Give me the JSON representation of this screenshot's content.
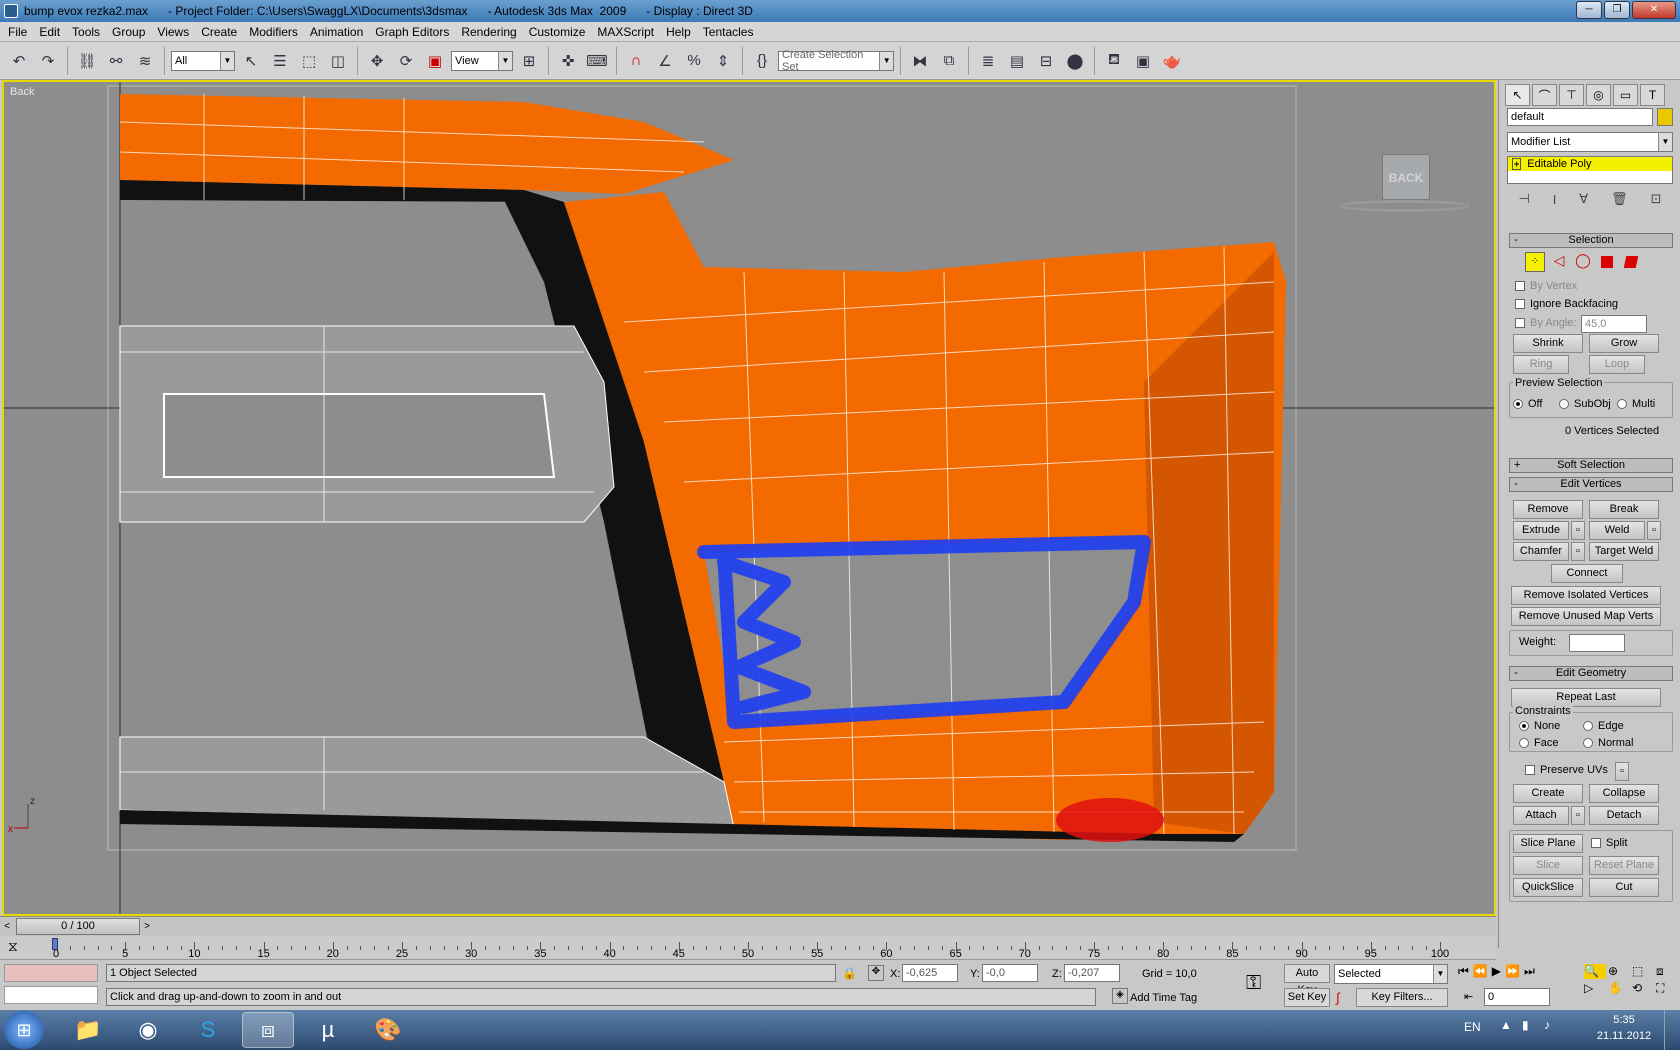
{
  "window": {
    "title": "bump evox rezka2.max      - Project Folder: C:\\Users\\SwaggLX\\Documents\\3dsmax      - Autodesk 3ds Max  2009      - Display : Direct 3D"
  },
  "menu": [
    "File",
    "Edit",
    "Tools",
    "Group",
    "Views",
    "Create",
    "Modifiers",
    "Animation",
    "Graph Editors",
    "Rendering",
    "Customize",
    "MAXScript",
    "Help",
    "Tentacles"
  ],
  "toolbar": {
    "filter_value": "All",
    "ref_coord_value": "View",
    "selection_set_placeholder": "Create Selection Set"
  },
  "viewport": {
    "label": "Back",
    "viewcube_label": "BACK"
  },
  "command_panel": {
    "object_name": "default",
    "modifier_list": "Modifier List",
    "stack_item": "Editable Poly",
    "object_color": "#e8c800",
    "selection": {
      "header": "Selection",
      "by_vertex": "By Vertex",
      "ignore_backfacing": "Ignore Backfacing",
      "by_angle": "By Angle:",
      "angle_value": "45,0",
      "shrink": "Shrink",
      "grow": "Grow",
      "ring": "Ring",
      "loop": "Loop",
      "preview_title": "Preview Selection",
      "preview_off": "Off",
      "preview_subobj": "SubObj",
      "preview_multi": "Multi",
      "status": "0 Vertices Selected"
    },
    "soft_selection": "Soft Selection",
    "edit_vertices": {
      "header": "Edit Vertices",
      "remove": "Remove",
      "break": "Break",
      "extrude": "Extrude",
      "weld": "Weld",
      "chamfer": "Chamfer",
      "target_weld": "Target Weld",
      "connect": "Connect",
      "remove_isolated": "Remove Isolated Vertices",
      "remove_unused": "Remove Unused Map Verts",
      "weight": "Weight:"
    },
    "edit_geometry": {
      "header": "Edit Geometry",
      "repeat_last": "Repeat Last",
      "constraints": "Constraints",
      "none": "None",
      "edge": "Edge",
      "face": "Face",
      "normal": "Normal",
      "preserve_uvs": "Preserve UVs",
      "create": "Create",
      "collapse": "Collapse",
      "attach": "Attach",
      "detach": "Detach",
      "slice_plane": "Slice Plane",
      "split": "Split",
      "slice": "Slice",
      "reset_plane": "Reset Plane",
      "quickslice": "QuickSlice",
      "cut": "Cut"
    }
  },
  "timeline": {
    "frame_display": "0 / 100",
    "ticks": [
      "0",
      "5",
      "10",
      "15",
      "20",
      "25",
      "30",
      "35",
      "40",
      "45",
      "50",
      "55",
      "60",
      "65",
      "70",
      "75",
      "80",
      "85",
      "90",
      "95",
      "100"
    ]
  },
  "status": {
    "selection": "1 Object Selected",
    "prompt": "Click and drag up-and-down to zoom in and out",
    "x_label": "X:",
    "x_value": "-0,625",
    "y_label": "Y:",
    "y_value": "-0,0",
    "z_label": "Z:",
    "z_value": "-0,207",
    "grid": "Grid = 10,0",
    "auto_key": "Auto Key",
    "key_mode": "Selected",
    "set_key": "Set Key",
    "key_filters": "Key Filters...",
    "add_time_tag": "Add Time Tag",
    "current_frame": "0"
  },
  "taskbar": {
    "language": "EN",
    "time": "5:35",
    "date": "21.11.2012"
  }
}
